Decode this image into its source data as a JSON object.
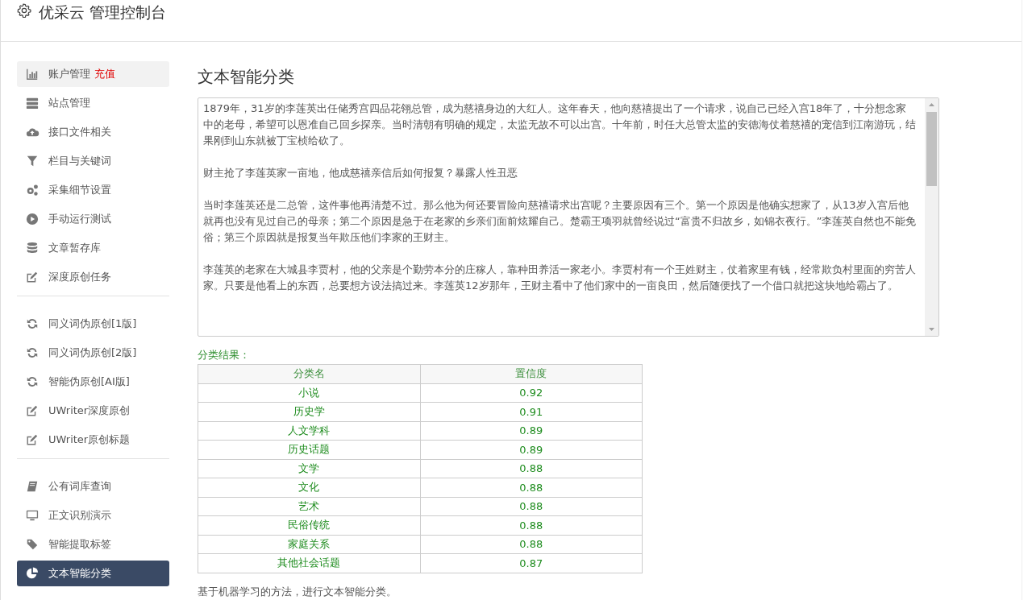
{
  "header": {
    "title": "优采云 管理控制台"
  },
  "sidebar": {
    "groups": [
      {
        "items": [
          {
            "label": "账户管理",
            "badge": "充值",
            "highlighted": true,
            "selected": false
          },
          {
            "label": "站点管理",
            "highlighted": false,
            "selected": false
          },
          {
            "label": "接口文件相关",
            "highlighted": false,
            "selected": false
          },
          {
            "label": "栏目与关键词",
            "highlighted": false,
            "selected": false
          },
          {
            "label": "采集细节设置",
            "highlighted": false,
            "selected": false
          },
          {
            "label": "手动运行测试",
            "highlighted": false,
            "selected": false
          },
          {
            "label": "文章暂存库",
            "highlighted": false,
            "selected": false
          },
          {
            "label": "深度原创任务",
            "highlighted": false,
            "selected": false
          }
        ]
      },
      {
        "items": [
          {
            "label": "同义词伪原创[1版]",
            "highlighted": false,
            "selected": false
          },
          {
            "label": "同义词伪原创[2版]",
            "highlighted": false,
            "selected": false
          },
          {
            "label": "智能伪原创[AI版]",
            "highlighted": false,
            "selected": false
          },
          {
            "label": "UWriter深度原创",
            "highlighted": false,
            "selected": false
          },
          {
            "label": "UWriter原创标题",
            "highlighted": false,
            "selected": false
          }
        ]
      },
      {
        "items": [
          {
            "label": "公有词库查询",
            "highlighted": false,
            "selected": false
          },
          {
            "label": "正文识别演示",
            "highlighted": false,
            "selected": false
          },
          {
            "label": "智能提取标签",
            "highlighted": false,
            "selected": false
          },
          {
            "label": "文本智能分类",
            "highlighted": false,
            "selected": true
          }
        ]
      }
    ]
  },
  "content": {
    "heading": "文本智能分类",
    "text_area": {
      "value": [
        "1879年，31岁的李莲英出任储秀宫四品花翎总管，成为慈禧身边的大红人。这年春天，他向慈禧提出了一个请求，说自己已经入宫18年了，十分想念家中的老母，希望可以恩准自己回乡探亲。当时清朝有明确的规定，太监无故不可以出宫。十年前，时任大总管太监的安德海仗着慈禧的宠信到江南游玩，结果刚到山东就被丁宝桢给砍了。",
        "财主抢了李莲英家一亩地，他成慈禧亲信后如何报复？暴露人性丑恶",
        "当时李莲英还是二总管，这件事他再清楚不过。那么他为何还要冒险向慈禧请求出宫呢？主要原因有三个。第一个原因是他确实想家了，从13岁入宫后他就再也没有见过自己的母亲；第二个原因是急于在老家的乡亲们面前炫耀自己。楚霸王项羽就曾经说过“富贵不归故乡，如锦衣夜行。”李莲英自然也不能免俗；第三个原因就是报复当年欺压他们李家的王财主。",
        "李莲英的老家在大城县李贾村，他的父亲是个勤劳本分的庄稼人，靠种田养活一家老小。李贾村有一个王姓财主，仗着家里有钱，经常欺负村里面的穷苦人家。只要是他看上的东西，总要想方设法搞过来。李莲英12岁那年，王财主看中了他们家中的一亩良田，然后随便找了一个借口就把这块地给霸占了。"
      ]
    },
    "result_label": "分类结果：",
    "table": {
      "columns": [
        "分类名",
        "置信度"
      ],
      "rows": [
        [
          "小说",
          "0.92"
        ],
        [
          "历史学",
          "0.91"
        ],
        [
          "人文学科",
          "0.89"
        ],
        [
          "历史话题",
          "0.89"
        ],
        [
          "文学",
          "0.88"
        ],
        [
          "文化",
          "0.88"
        ],
        [
          "艺术",
          "0.88"
        ],
        [
          "民俗传统",
          "0.88"
        ],
        [
          "家庭关系",
          "0.88"
        ],
        [
          "其他社会话题",
          "0.87"
        ]
      ]
    },
    "description": "基于机器学习的方法，进行文本智能分类。"
  }
}
